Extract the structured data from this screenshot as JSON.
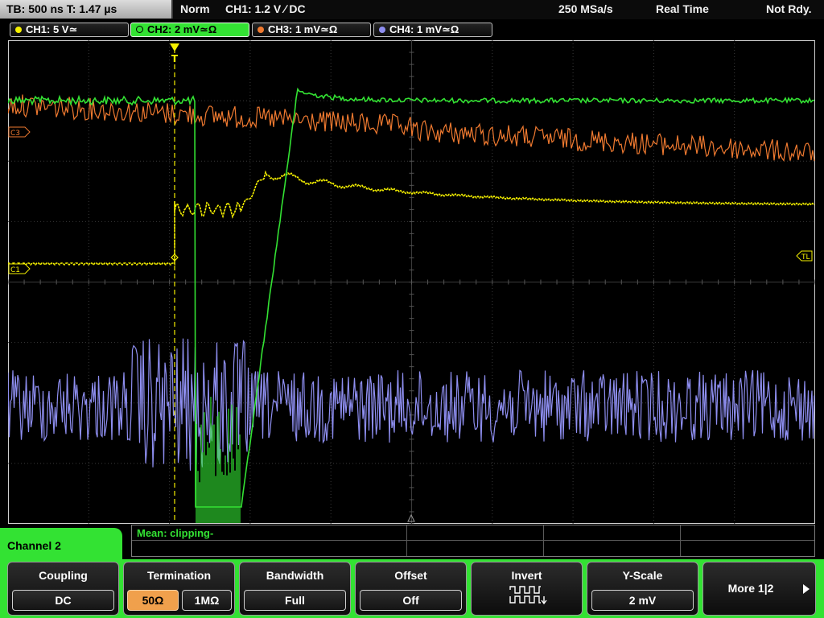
{
  "top_bar": {
    "tb_label": "TB: 500 ns   T: 1.47 µs",
    "trigger_mode": "Norm",
    "trigger_info": "CH1: 1.2 V ∕ DC",
    "sample_rate": "250 MSa/s",
    "acq_mode": "Real Time",
    "status": "Not Rdy."
  },
  "channels": [
    {
      "label": "CH1: 5 V≃",
      "color": "#f5f000"
    },
    {
      "label": "CH2: 2 mV≃Ω",
      "color": "#33e233"
    },
    {
      "label": "CH3: 1 mV≃Ω",
      "color": "#f07a30"
    },
    {
      "label": "CH4: 1 mV≃Ω",
      "color": "#8e8ef0"
    }
  ],
  "markers": {
    "trigger": "T",
    "c1": "C1",
    "c3": "C3",
    "tl": "TL"
  },
  "measurement": {
    "text": "Mean: clipping-"
  },
  "channel_menu": {
    "title": "Channel 2"
  },
  "softkeys": {
    "coupling": {
      "title": "Coupling",
      "value": "DC"
    },
    "termination": {
      "title": "Termination",
      "opt1": "50Ω",
      "opt2": "1MΩ"
    },
    "bandwidth": {
      "title": "Bandwidth",
      "value": "Full"
    },
    "offset": {
      "title": "Offset",
      "value": "Off"
    },
    "invert": {
      "title": "Invert"
    },
    "yscale": {
      "title": "Y-Scale",
      "value": "2 mV"
    },
    "more": {
      "label": "More 1|2"
    }
  },
  "colors": {
    "ch1": "#f5f000",
    "ch2": "#33e233",
    "ch3": "#f07a30",
    "ch4": "#8e8ef0",
    "menu_accent": "#33e233",
    "selected_option": "#f0a04c"
  }
}
